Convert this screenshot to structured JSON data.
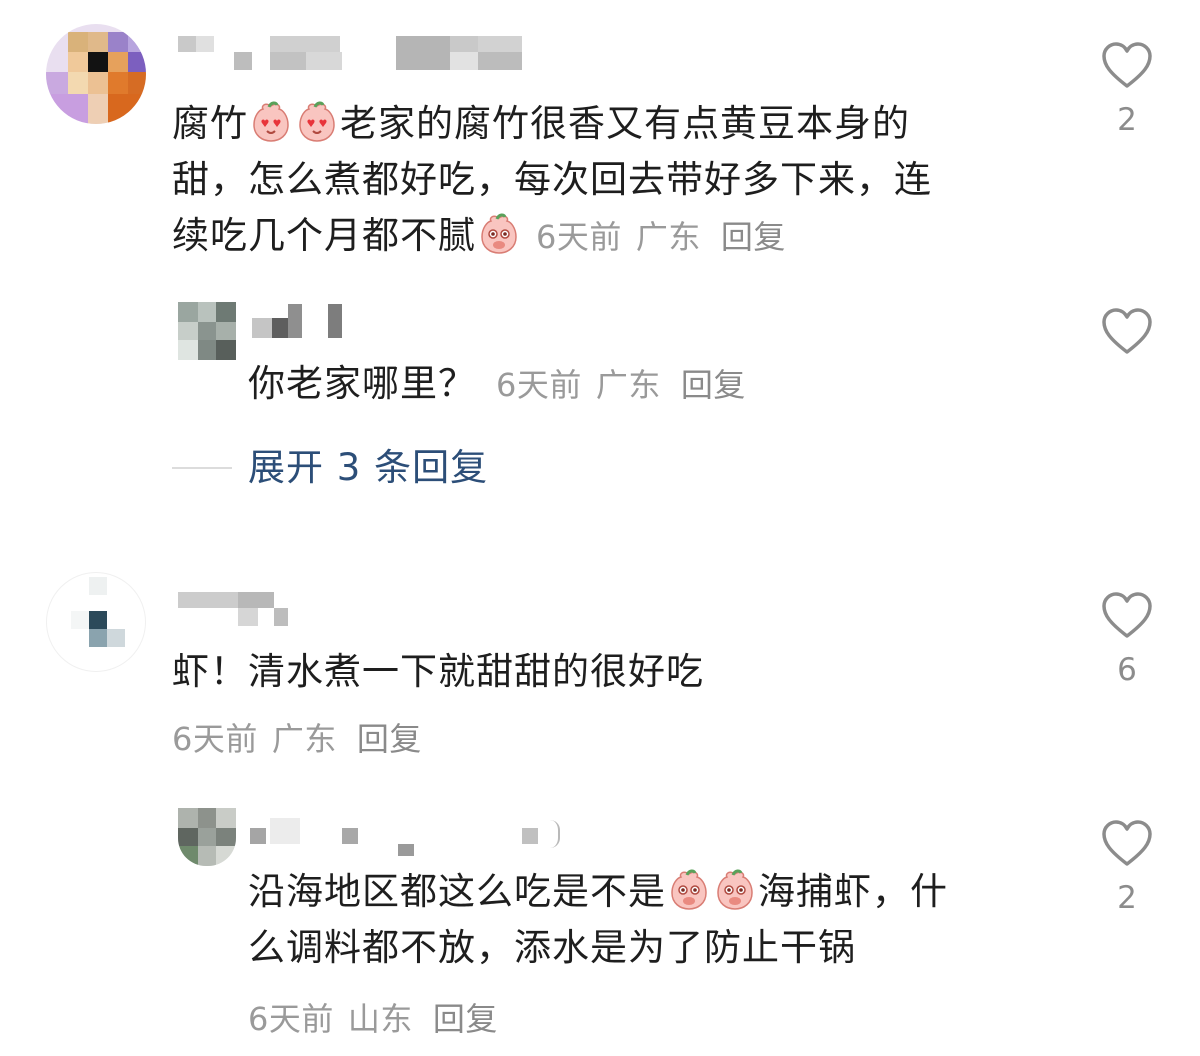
{
  "comments": [
    {
      "text_lines": [
        "腐竹",
        "老家的腐竹很香又有点黄豆本身的",
        "甜，怎么煮都好吃，每次回去带好多下来，连",
        "续吃几个月都不腻"
      ],
      "time": "6天前",
      "location": "广东",
      "reply_label": "回复",
      "likes": "2",
      "emoji": "peach-heart-eyes",
      "replies": [
        {
          "text": "你老家哪里？",
          "time": "6天前",
          "location": "广东",
          "reply_label": "回复"
        }
      ],
      "expand_label": "展开 3 条回复"
    },
    {
      "text": "虾！清水煮一下就甜甜的很好吃",
      "time": "6天前",
      "location": "广东",
      "reply_label": "回复",
      "likes": "6",
      "replies": [
        {
          "text_lines": [
            "沿海地区都这么吃是不是",
            "海捕虾，什",
            "么调料都不放，添水是为了防止干锅"
          ],
          "time": "6天前",
          "location": "山东",
          "reply_label": "回复",
          "likes": "2"
        }
      ]
    }
  ],
  "colors": {
    "meta": "#9a9a9a",
    "link": "#2c4e78",
    "icon": "#8c8c8c"
  },
  "icons": {
    "like": "heart-outline-icon"
  }
}
